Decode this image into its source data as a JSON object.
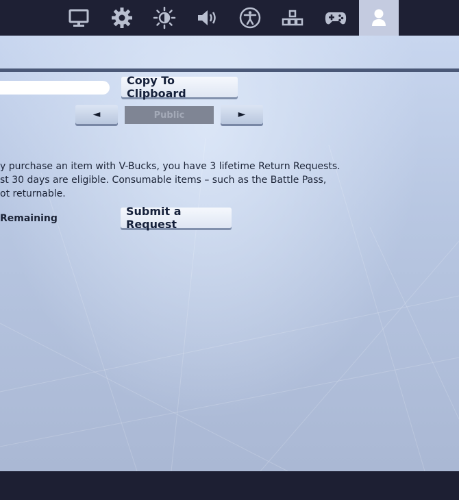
{
  "nav": {
    "tabs": [
      {
        "icon": "monitor-icon",
        "active": false
      },
      {
        "icon": "gear-icon",
        "active": false
      },
      {
        "icon": "brightness-icon",
        "active": false
      },
      {
        "icon": "speaker-icon",
        "active": false
      },
      {
        "icon": "accessibility-icon",
        "active": false
      },
      {
        "icon": "input-layout-icon",
        "active": false
      },
      {
        "icon": "gamepad-icon",
        "active": false
      },
      {
        "icon": "account-icon",
        "active": true
      }
    ]
  },
  "account": {
    "copy_label": "Copy To Clipboard",
    "visibility": {
      "prev_arrow": "◄",
      "value": "Public",
      "next_arrow": "►"
    },
    "description": "y purchase an item with V-Bucks, you have 3 lifetime Return Requests.\nst 30 days are eligible. Consumable items – such as the Battle Pass,\not returnable.",
    "remaining_label": "Remaining",
    "submit_label": "Submit a Request"
  },
  "colors": {
    "topbar": "#1e2034",
    "active_tab": "#c4cbe0",
    "icon": "#b9bfd0",
    "active_icon": "#ffffff",
    "text": "#1a2235"
  }
}
